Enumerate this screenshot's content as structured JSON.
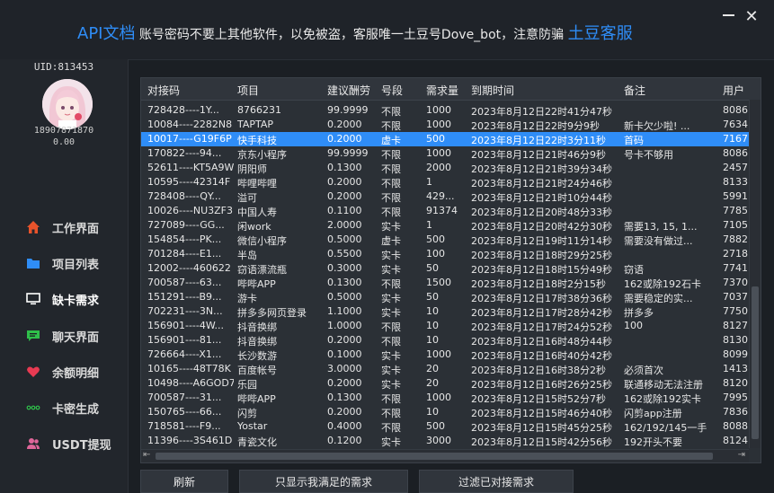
{
  "banner": {
    "api": "API文档",
    "message": " 账号密码不要上其他软件，以免被盗，客服唯一土豆号Dove_bot，注意防骗 ",
    "support": "土豆客服"
  },
  "window": {
    "close_glyph": "✕"
  },
  "profile": {
    "uid": "UID:813453",
    "phone": "18907871870",
    "balance": "0.00"
  },
  "nav": [
    {
      "label": "工作界面",
      "icon": "home-icon",
      "color": "#e8532b"
    },
    {
      "label": "项目列表",
      "icon": "folder-icon",
      "color": "#2f8df7"
    },
    {
      "label": "缺卡需求",
      "icon": "monitor-icon",
      "color": "#ffffff"
    },
    {
      "label": "聊天界面",
      "icon": "chat-icon",
      "color": "#2fbf4a"
    },
    {
      "label": "余额明细",
      "icon": "heart-icon",
      "color": "#e83a52"
    },
    {
      "label": "卡密生成",
      "icon": "dots-icon",
      "color": "#2fbf4a"
    },
    {
      "label": "USDT提现",
      "icon": "users-icon",
      "color": "#e0669a"
    }
  ],
  "table": {
    "columns": [
      "对接码",
      "项目",
      "建议酬劳",
      "号段",
      "需求量",
      "到期时间",
      "备注",
      "用户"
    ],
    "rows": [
      [
        "728428----1Y...",
        "8766231",
        "99.9999",
        "不限",
        "1000",
        "2023年8月12日22时41分47秒",
        "",
        "8086"
      ],
      [
        "10084----2282N8",
        "TAPTAP",
        "0.2000",
        "不限",
        "1000",
        "2023年8月12日22时9分9秒",
        "新卡欠少啦! ...",
        "7634"
      ],
      [
        "10017----G19F6P",
        "快手科技",
        "0.2000",
        "虚卡",
        "500",
        "2023年8月12日22时3分11秒",
        "首码",
        "7167"
      ],
      [
        "170822----94...",
        "京东小程序",
        "99.9999",
        "不限",
        "1000",
        "2023年8月12日21时46分9秒",
        "号卡不够用",
        "8086"
      ],
      [
        "52611----KT5A9W",
        "阴阳师",
        "0.1300",
        "不限",
        "2000",
        "2023年8月12日21时39分34秒",
        "",
        "2457"
      ],
      [
        "10595----42314F",
        "哔哩哔哩",
        "0.2000",
        "不限",
        "1",
        "2023年8月12日21时24分46秒",
        "",
        "8133"
      ],
      [
        "728408----QY...",
        "溢可",
        "0.2000",
        "不限",
        "429...",
        "2023年8月12日21时10分44秒",
        "",
        "5991"
      ],
      [
        "10026----NU3ZF3",
        "中国人寿",
        "0.1100",
        "不限",
        "91374",
        "2023年8月12日20时48分33秒",
        "",
        "7785"
      ],
      [
        "727089----GG...",
        "闲work",
        "2.0000",
        "实卡",
        "1",
        "2023年8月12日20时42分30秒",
        "需要13, 15, 1...",
        "7105"
      ],
      [
        "154854----PK...",
        "微信小程序",
        "0.5000",
        "虚卡",
        "500",
        "2023年8月12日19时11分14秒",
        "需要没有做过...",
        "7882"
      ],
      [
        "701284----E1...",
        "半岛",
        "0.5500",
        "实卡",
        "100",
        "2023年8月12日18时29分25秒",
        "",
        "2718"
      ],
      [
        "12002----460622",
        "窃语漂流瓶",
        "0.3000",
        "实卡",
        "50",
        "2023年8月12日18时15分49秒",
        "窃语",
        "7741"
      ],
      [
        "700587----63...",
        "哔哔APP",
        "0.1300",
        "不限",
        "1500",
        "2023年8月12日18时2分15秒",
        "162或除192石卡",
        "7370"
      ],
      [
        "151291----B9...",
        "游卡",
        "0.5000",
        "实卡",
        "50",
        "2023年8月12日17时38分36秒",
        "需要稳定的实...",
        "7037"
      ],
      [
        "702231----3N...",
        "拼多多网页登录",
        "1.1000",
        "实卡",
        "10",
        "2023年8月12日17时28分42秒",
        "拼多多",
        "7750"
      ],
      [
        "156901----4W...",
        "抖音换绑",
        "1.0000",
        "不限",
        "10",
        "2023年8月12日17时24分52秒",
        "100",
        "8127"
      ],
      [
        "156901----81...",
        "抖音换绑",
        "0.2000",
        "不限",
        "10",
        "2023年8月12日16时48分44秒",
        "",
        "8130"
      ],
      [
        "726664----X1...",
        "长沙数游",
        "0.1000",
        "实卡",
        "1000",
        "2023年8月12日16时40分42秒",
        "",
        "8099"
      ],
      [
        "10165----48T78K",
        "百度帐号",
        "3.0000",
        "实卡",
        "20",
        "2023年8月12日16时38分2秒",
        "必须首次",
        "1413"
      ],
      [
        "10498----A6GOD7",
        "乐园",
        "0.2000",
        "实卡",
        "20",
        "2023年8月12日16时26分25秒",
        "联通移动无法注册",
        "8120"
      ],
      [
        "700587----31...",
        "哔哔APP",
        "0.1300",
        "不限",
        "1000",
        "2023年8月12日15时52分7秒",
        "162或除192实卡",
        "7995"
      ],
      [
        "150765----66...",
        "闪剪",
        "0.2000",
        "不限",
        "10",
        "2023年8月12日15时46分40秒",
        "闪剪app注册",
        "7836"
      ],
      [
        "718581----F9...",
        "Yostar",
        "0.4000",
        "不限",
        "500",
        "2023年8月12日15时45分25秒",
        "162/192/145一手",
        "8088"
      ],
      [
        "11396----3S461D",
        "青瓷文化",
        "0.1200",
        "实卡",
        "3000",
        "2023年8月12日15时42分56秒",
        "192开头不要",
        "8124"
      ]
    ],
    "selected_index": 2
  },
  "scroll": {
    "left": "⇤",
    "right": "⇥"
  },
  "buttons": {
    "refresh": "刷新",
    "only_mine": "只显示我满足的需求",
    "filter_done": "过滤已对接需求"
  }
}
